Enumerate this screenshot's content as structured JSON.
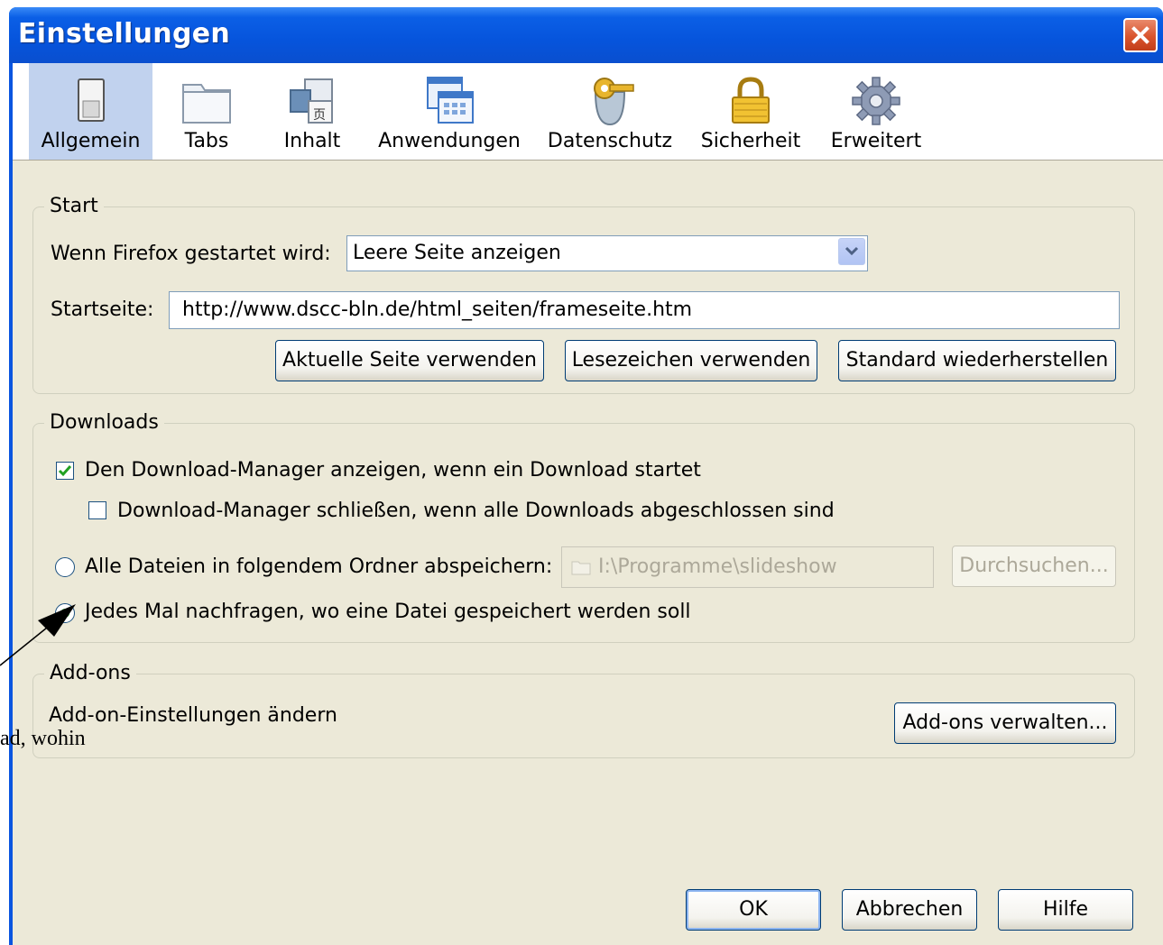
{
  "window": {
    "title": "Einstellungen"
  },
  "toolbar": {
    "items": [
      {
        "label": "Allgemein",
        "icon": "general-switch-icon",
        "selected": true
      },
      {
        "label": "Tabs",
        "icon": "tabs-folder-icon",
        "selected": false
      },
      {
        "label": "Inhalt",
        "icon": "content-page-icon",
        "selected": false
      },
      {
        "label": "Anwendungen",
        "icon": "applications-window-icon",
        "selected": false
      },
      {
        "label": "Datenschutz",
        "icon": "privacy-key-icon",
        "selected": false
      },
      {
        "label": "Sicherheit",
        "icon": "security-lock-icon",
        "selected": false
      },
      {
        "label": "Erweitert",
        "icon": "advanced-gear-icon",
        "selected": false
      }
    ]
  },
  "start": {
    "legend": "Start",
    "on_start_label": "Wenn Firefox gestartet wird:",
    "on_start_value": "Leere Seite anzeigen",
    "homepage_label": "Startseite:",
    "homepage_value": "http://www.dscc-bln.de/html_seiten/frameseite.htm",
    "use_current": "Aktuelle Seite verwenden",
    "use_bookmark": "Lesezeichen verwenden",
    "restore_default": "Standard wiederherstellen"
  },
  "downloads": {
    "legend": "Downloads",
    "show_manager": "Den Download-Manager anzeigen, wenn ein Download startet",
    "show_manager_checked": true,
    "close_manager": "Download-Manager schließen, wenn alle Downloads abgeschlossen sind",
    "close_manager_checked": false,
    "save_to": "Alle Dateien in folgendem Ordner abspeichern:",
    "folder": "I:\\Programme\\slideshow",
    "browse": "Durchsuchen...",
    "ask_each_time": "Jedes Mal nachfragen, wo eine Datei gespeichert werden soll",
    "selected_option": "ask_each_time"
  },
  "addons": {
    "legend": "Add-ons",
    "description": "Add-on-Einstellungen ändern",
    "manage": "Add-ons verwalten..."
  },
  "footer": {
    "ok": "OK",
    "cancel": "Abbrechen",
    "help": "Hilfe"
  },
  "annotation": {
    "text": "ad, wohin"
  },
  "colors": {
    "titlebar": "#0654dc",
    "selected_tab": "#c1d2ee",
    "dialog_bg": "#ece9d8",
    "radio_on": "#21a121"
  }
}
